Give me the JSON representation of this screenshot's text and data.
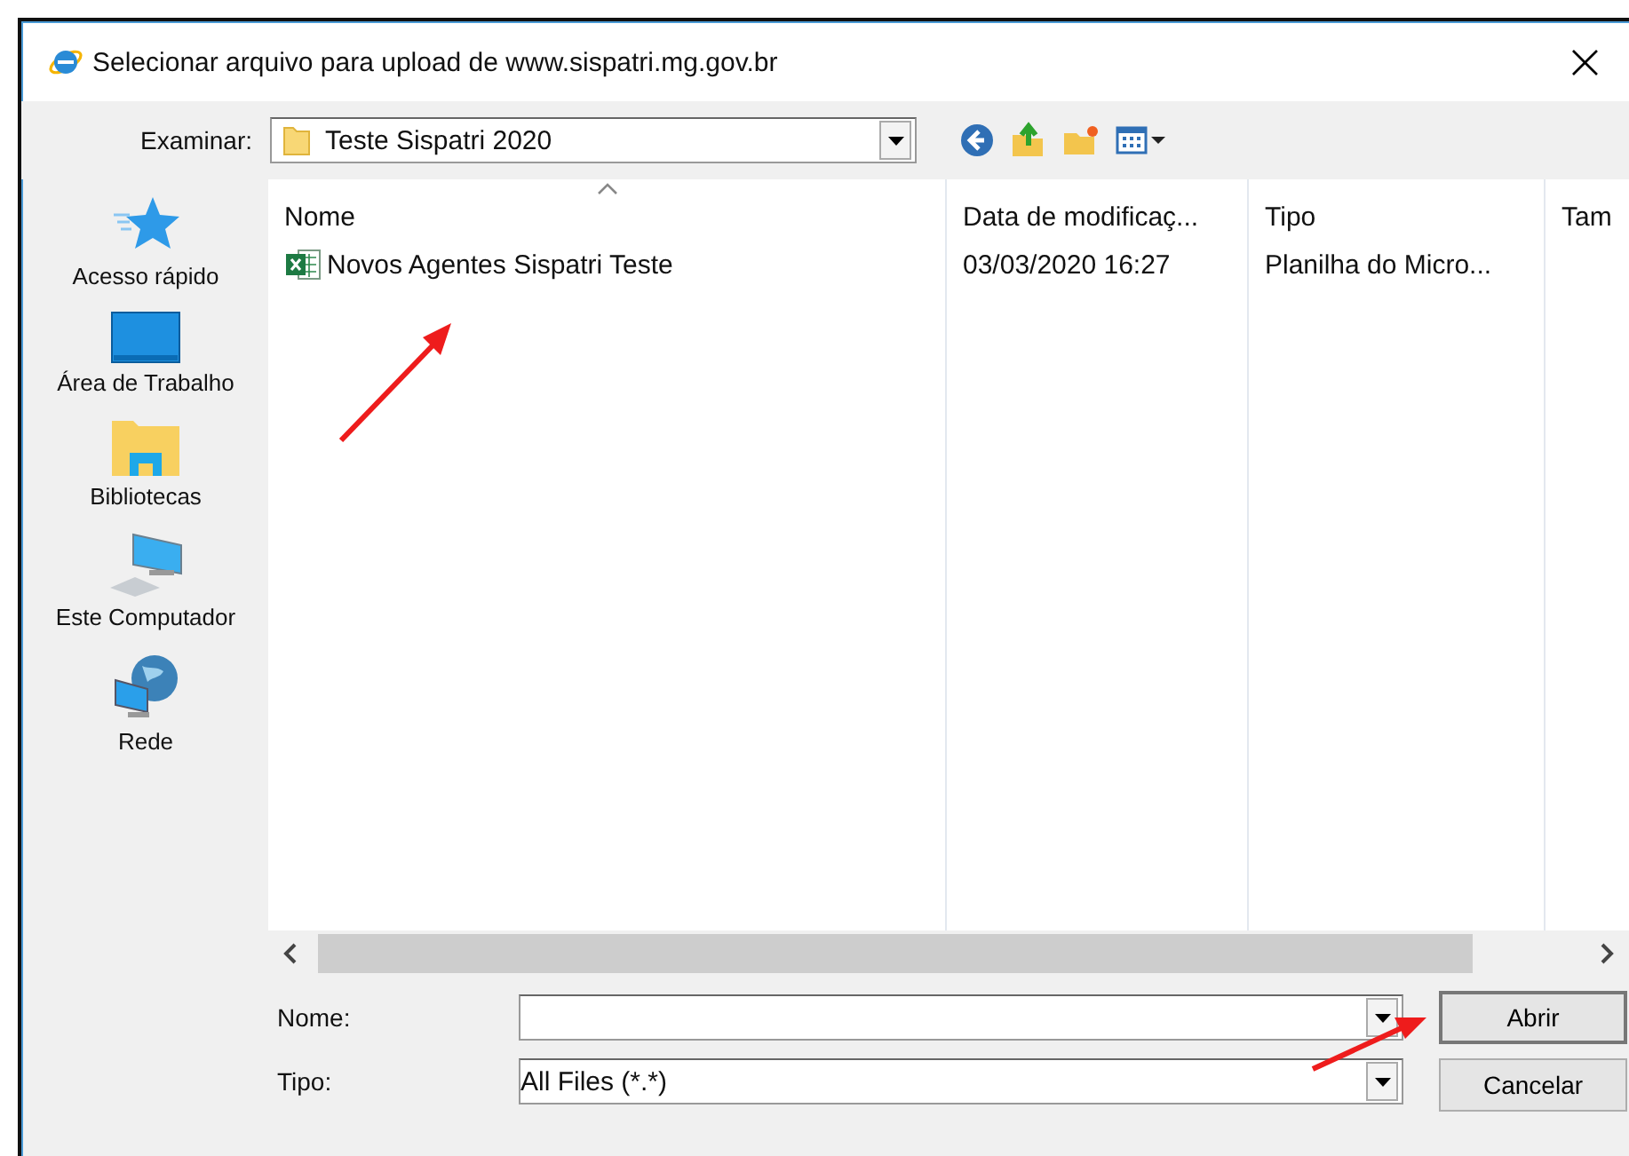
{
  "window": {
    "title": "Selecionar arquivo para upload de www.sispatri.mg.gov.br",
    "close": "×"
  },
  "location": {
    "label": "Examinar:",
    "value": "Teste Sispatri 2020"
  },
  "sidebar": {
    "items": [
      {
        "label": "Acesso rápido",
        "kind": "star"
      },
      {
        "label": "Área de Trabalho",
        "kind": "desktop"
      },
      {
        "label": "Bibliotecas",
        "kind": "library"
      },
      {
        "label": "Este Computador",
        "kind": "computer"
      },
      {
        "label": "Rede",
        "kind": "network"
      }
    ]
  },
  "table": {
    "columns": [
      "Nome",
      "Data de modificaç...",
      "Tipo",
      "Tam"
    ],
    "rows": [
      {
        "cells": [
          "Novos Agentes Sispatri Teste",
          "03/03/2020 16:27",
          "Planilha do Micro..."
        ],
        "kind": "spreadsheet"
      }
    ]
  },
  "fields": [
    {
      "label": "Nome:"
    },
    {
      "label": "Tipo:",
      "value": "All Files (*.*)"
    }
  ],
  "buttons": [
    "Abrir",
    "Cancelar"
  ]
}
